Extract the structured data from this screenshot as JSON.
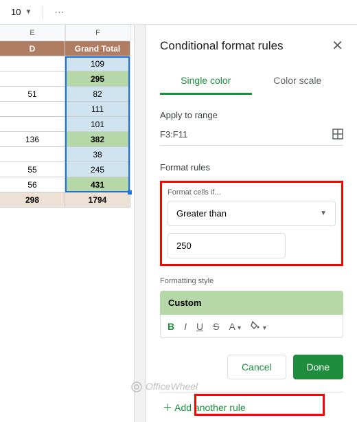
{
  "toolbar": {
    "font_size": "10",
    "more": "⋯"
  },
  "sheet": {
    "columns": [
      "E",
      "F"
    ],
    "header_row": {
      "d": "D",
      "gt": "Grand Total"
    },
    "rows": [
      {
        "e": "",
        "f": "109",
        "f_hl": false
      },
      {
        "e": "",
        "f": "295",
        "f_hl": true
      },
      {
        "e": "51",
        "f": "82",
        "f_hl": false
      },
      {
        "e": "",
        "f": "111",
        "f_hl": false
      },
      {
        "e": "",
        "f": "101",
        "f_hl": false
      },
      {
        "e": "136",
        "f": "382",
        "f_hl": true
      },
      {
        "e": "",
        "f": "38",
        "f_hl": false
      },
      {
        "e": "55",
        "f": "245",
        "f_hl": false
      },
      {
        "e": "56",
        "f": "431",
        "f_hl": true
      }
    ],
    "total_row": {
      "e": "298",
      "f": "1794"
    }
  },
  "panel": {
    "title": "Conditional format rules",
    "tabs": {
      "single": "Single color",
      "scale": "Color scale"
    },
    "apply_label": "Apply to range",
    "range": "F3:F11",
    "format_rules_label": "Format rules",
    "format_cells_if": "Format cells if...",
    "condition": "Greater than",
    "value": "250",
    "formatting_style_label": "Formatting style",
    "style_name": "Custom",
    "toolbar_items": {
      "b": "B",
      "i": "I",
      "u": "U",
      "s": "S",
      "a": "A",
      "fill": "⬛"
    },
    "cancel": "Cancel",
    "done": "Done",
    "add_rule": "＋ Add another rule"
  },
  "watermark": "OfficeWheel"
}
